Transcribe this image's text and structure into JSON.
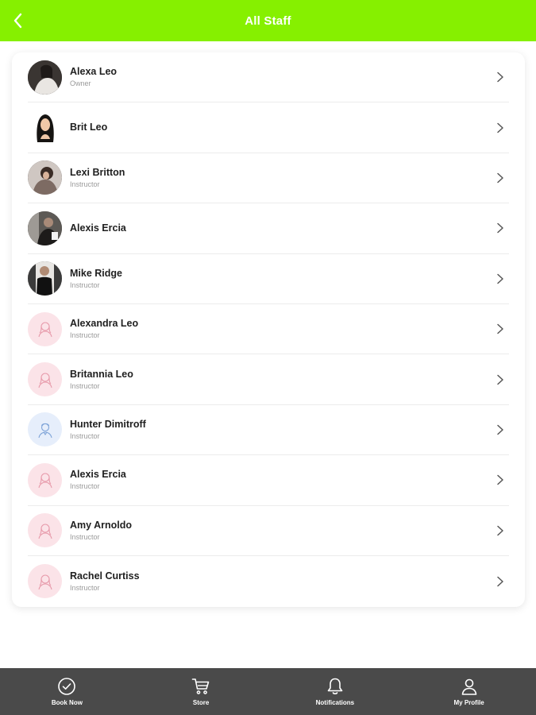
{
  "colors": {
    "accent": "#86f000",
    "bottom_bar": "#4a4a4a"
  },
  "header": {
    "title": "All Staff",
    "back_icon": "chevron-left-icon"
  },
  "staff": [
    {
      "name": "Alexa Leo",
      "role": "Owner",
      "avatar": "photo"
    },
    {
      "name": "Brit Leo",
      "role": "",
      "avatar": "illustration"
    },
    {
      "name": "Lexi Britton",
      "role": "Instructor",
      "avatar": "photo"
    },
    {
      "name": "Alexis Ercia",
      "role": "",
      "avatar": "photo"
    },
    {
      "name": "Mike Ridge",
      "role": "Instructor",
      "avatar": "photo"
    },
    {
      "name": "Alexandra Leo",
      "role": "Instructor",
      "avatar": "placeholder-female-icon"
    },
    {
      "name": "Britannia Leo",
      "role": "Instructor",
      "avatar": "placeholder-female-icon"
    },
    {
      "name": "Hunter Dimitroff",
      "role": "Instructor",
      "avatar": "placeholder-male-icon"
    },
    {
      "name": "Alexis Ercia",
      "role": "Instructor",
      "avatar": "placeholder-female-icon"
    },
    {
      "name": "Amy Arnoldo",
      "role": "Instructor",
      "avatar": "placeholder-female-icon"
    },
    {
      "name": "Rachel Curtiss",
      "role": "Instructor",
      "avatar": "placeholder-female-icon"
    }
  ],
  "bottom_nav": [
    {
      "label": "Book Now",
      "icon": "check-circle-icon"
    },
    {
      "label": "Store",
      "icon": "cart-icon"
    },
    {
      "label": "Notifications",
      "icon": "bell-icon"
    },
    {
      "label": "My Profile",
      "icon": "user-icon"
    }
  ]
}
